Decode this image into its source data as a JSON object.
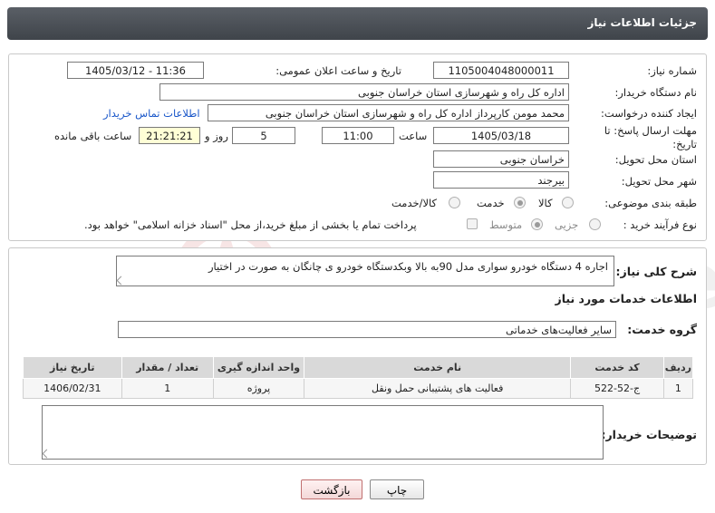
{
  "header": {
    "title": "جزئیات اطلاعات نیاز"
  },
  "info": {
    "need_number_label": "شماره نیاز:",
    "need_number": "1105004048000011",
    "announce_label": "تاریخ و ساعت اعلان عمومی:",
    "announce_value": "1405/03/12 - 11:36",
    "buyer_org_label": "نام دستگاه خریدار:",
    "buyer_org": "اداره کل راه و شهرسازی استان خراسان جنوبی",
    "creator_label": "ایجاد کننده درخواست:",
    "creator": "محمد مومن کارپرداز اداره کل راه و شهرسازی استان خراسان جنوبی",
    "contact_link": "اطلاعات تماس خریدار",
    "deadline_label": "مهلت ارسال پاسخ: تا تاریخ:",
    "deadline_date": "1405/03/18",
    "time_label": "ساعت",
    "deadline_time": "11:00",
    "days_value": "5",
    "days_label": "روز و",
    "remaining_time": "21:21:21",
    "remaining_label": "ساعت باقی مانده",
    "province_label": "استان محل تحویل:",
    "province": "خراسان جنوبی",
    "city_label": "شهر محل تحویل:",
    "city": "بیرجند",
    "category_label": "طبقه بندی موضوعی:",
    "category_options": [
      "کالا",
      "خدمت",
      "کالا/خدمت"
    ],
    "category_selected": "خدمت",
    "purchase_label": "نوع فرآیند خرید :",
    "purchase_options": [
      "جزیی",
      "متوسط"
    ],
    "purchase_selected": "متوسط",
    "treasury_note": "پرداخت تمام یا بخشی از مبلغ خرید،از محل \"اسناد خزانه اسلامی\" خواهد بود."
  },
  "summary": {
    "label": "شرح کلی نیاز:",
    "text": "اجاره 4 دستگاه خودرو سواری مدل 90به بالا وبکدستگاه خودرو ی چانگان به صورت در اختیار"
  },
  "services": {
    "section_title": "اطلاعات خدمات مورد نیاز",
    "group_label": "گروه خدمت:",
    "group_value": "سایر فعالیت‌های خدماتی",
    "columns": [
      "ردیف",
      "کد خدمت",
      "نام خدمت",
      "واحد اندازه گیری",
      "تعداد / مقدار",
      "تاریخ نیاز"
    ],
    "rows": [
      [
        "1",
        "ج-52-522",
        "فعالیت های پشتیبانی حمل ونقل",
        "پروژه",
        "1",
        "1406/02/31"
      ]
    ]
  },
  "buyer_notes": {
    "label": "توضیحات خریدار:",
    "text": ""
  },
  "buttons": {
    "print": "چاپ",
    "back": "بازگشت"
  },
  "watermark": {
    "text": "AriaTender.net"
  },
  "colors": {
    "header_bg": "#4a4f55",
    "link": "#1a57c9",
    "highlight_field": "#ffffd6"
  }
}
